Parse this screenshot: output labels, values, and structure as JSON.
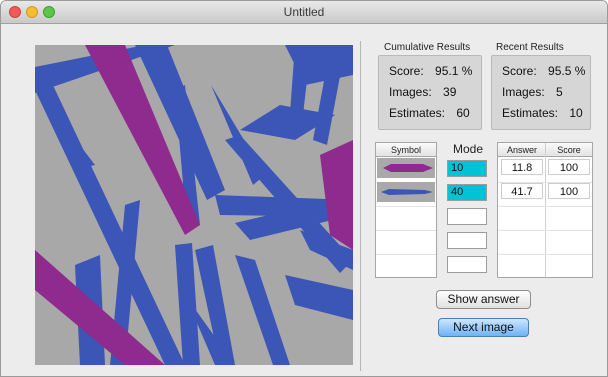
{
  "window": {
    "title": "Untitled"
  },
  "colors": {
    "canvas_bg": "#a8a8a8",
    "blue": "#3b56b6",
    "purple": "#8f2a8f",
    "mode_highlight": "#00c3d6"
  },
  "cumulative": {
    "heading": "Cumulative Results",
    "score_label": "Score:",
    "score_value": "95.1 %",
    "images_label": "Images:",
    "images_value": "39",
    "estimates_label": "Estimates:",
    "estimates_value": "60"
  },
  "recent": {
    "heading": "Recent Results",
    "score_label": "Score:",
    "score_value": "95.5 %",
    "images_label": "Images:",
    "images_value": "5",
    "estimates_label": "Estimates:",
    "estimates_value": "10"
  },
  "symbol_table": {
    "header": "Symbol",
    "symbols": [
      "purple-bar-icon",
      "blue-bar-icon"
    ]
  },
  "mode": {
    "label": "Mode",
    "values": [
      "10",
      "40",
      "",
      "",
      ""
    ]
  },
  "answer_table": {
    "headers": [
      "Answer",
      "Score"
    ],
    "rows": [
      [
        "11.8",
        "100"
      ],
      [
        "41.7",
        "100"
      ]
    ]
  },
  "buttons": {
    "show_answer": "Show answer",
    "next_image": "Next image"
  }
}
